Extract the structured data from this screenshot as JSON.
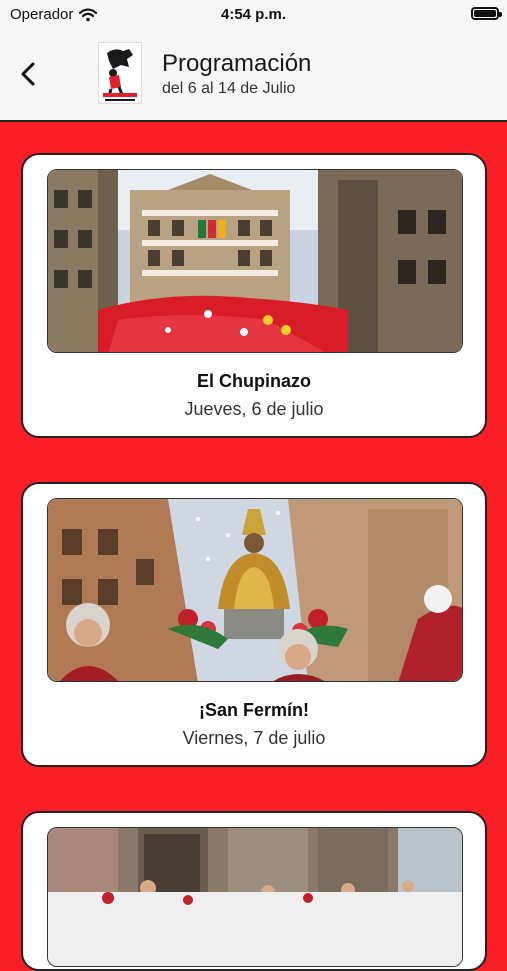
{
  "status_bar": {
    "carrier": "Operador",
    "time": "4:54 p.m."
  },
  "header": {
    "title": "Programación",
    "subtitle": "del 6 al 14 de Julio"
  },
  "events": [
    {
      "title": "El Chupinazo",
      "date": "Jueves, 6 de julio"
    },
    {
      "title": "¡San Fermín!",
      "date": "Viernes, 7 de julio"
    },
    {
      "title": "",
      "date": ""
    }
  ],
  "colors": {
    "background": "#fa1f26",
    "card": "#ffffff",
    "header": "#f6f6f6"
  },
  "icons": [
    "wifi-icon",
    "battery-icon",
    "back-chevron-icon"
  ]
}
